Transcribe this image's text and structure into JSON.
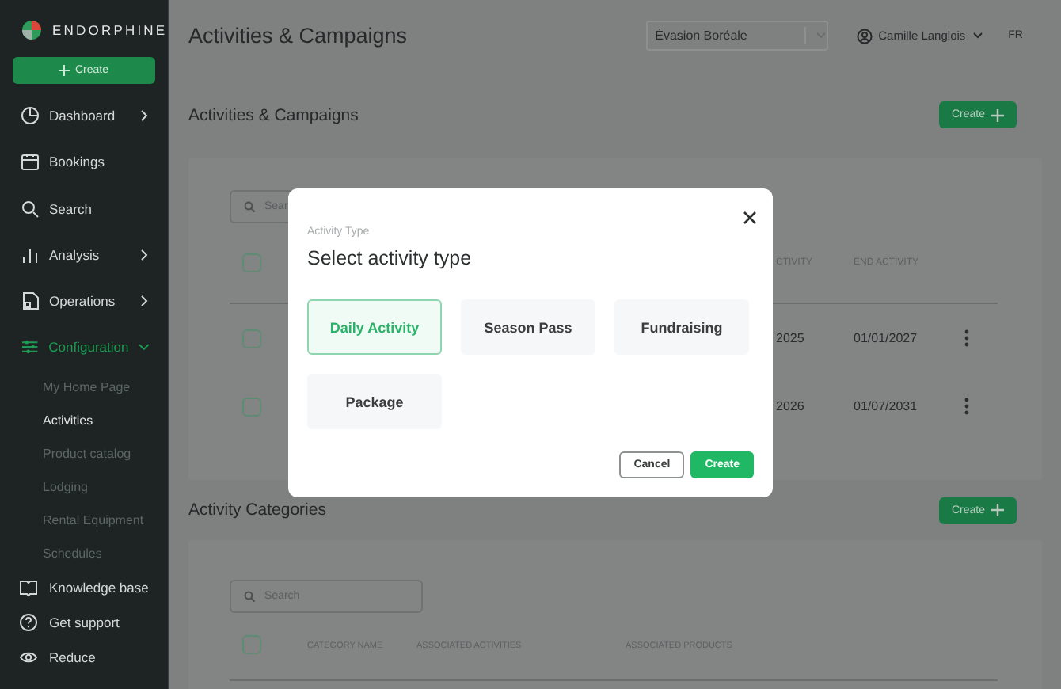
{
  "sidebar": {
    "brand": "ENDORPHINE",
    "create_button": "Create",
    "nav_items": [
      {
        "label": "Dashboard",
        "kind": "group",
        "expanded": false,
        "selected": false
      },
      {
        "label": "Bookings",
        "kind": "link",
        "selected": false
      },
      {
        "label": "Search",
        "kind": "link",
        "selected": false
      },
      {
        "label": "Analysis",
        "kind": "group",
        "expanded": false,
        "selected": false
      },
      {
        "label": "Operations",
        "kind": "group",
        "expanded": false,
        "selected": false
      },
      {
        "label": "Configuration",
        "kind": "group",
        "expanded": true,
        "selected": true
      }
    ],
    "sub_items": [
      {
        "label": "My Home Page",
        "selected": false
      },
      {
        "label": "Activities",
        "selected": true
      },
      {
        "label": "Product catalog",
        "selected": false
      },
      {
        "label": "Lodging",
        "selected": false
      },
      {
        "label": "Rental Equipment",
        "selected": false
      },
      {
        "label": "Schedules",
        "selected": false
      }
    ],
    "bottom_items": [
      "Knowledge base",
      "Get support",
      "Reduce"
    ]
  },
  "header": {
    "title": "Activities & Campaigns",
    "organization": "Évasion Boréale",
    "user": "Camille Langlois",
    "language": "FR"
  },
  "campaigns": {
    "title": "Activities & Campaigns",
    "create_button": "Create",
    "search": {
      "placeholder": "Sear"
    },
    "select_all_checked": false,
    "columns": [
      "CTIVITY",
      "END ACTIVITY"
    ],
    "rows": [
      {
        "checked": false,
        "cells": [
          "2025",
          "01/01/2027"
        ]
      },
      {
        "checked": false,
        "cells": [
          "2026",
          "01/07/2031"
        ]
      }
    ]
  },
  "categories": {
    "title": "Activity Categories",
    "create_button": "Create",
    "search": {
      "placeholder": "Search"
    },
    "select_all_checked": false,
    "columns": [
      "CATEGORY NAME",
      "ASSOCIATED ACTIVITIES",
      "ASSOCIATED PRODUCTS"
    ]
  },
  "dialog": {
    "subtitle": "Activity Type",
    "title": "Select activity type",
    "options": [
      {
        "label": "Daily Activity",
        "selected": true
      },
      {
        "label": "Season Pass",
        "selected": false
      },
      {
        "label": "Fundraising",
        "selected": false
      },
      {
        "label": "Package",
        "selected": false
      }
    ],
    "cancel_button": "Cancel",
    "create_button": "Create"
  }
}
